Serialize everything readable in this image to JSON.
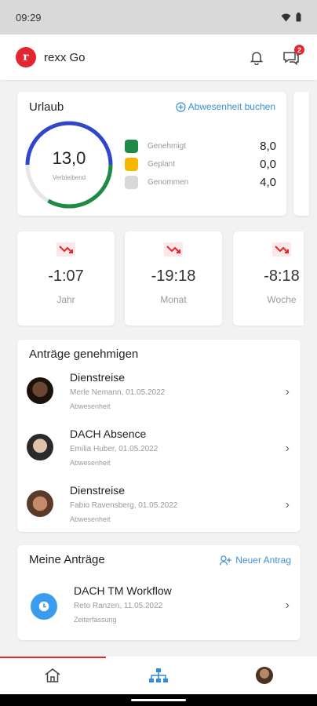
{
  "status": {
    "time": "09:29"
  },
  "app": {
    "title": "rexx Go",
    "messages_badge": "2"
  },
  "vacation": {
    "title": "Urlaub",
    "book_label": "Abwesenheit buchen",
    "remaining_value": "13,0",
    "remaining_label": "Verbleibend",
    "colors": {
      "approved": "#1e8a46",
      "planned": "#f5b800",
      "taken": "#d9d9d9",
      "ring_blue": "#3147c9"
    },
    "legend": [
      {
        "label": "Genehmigt",
        "value": "8,0"
      },
      {
        "label": "Geplant",
        "value": "0,0"
      },
      {
        "label": "Genommen",
        "value": "4,0"
      }
    ]
  },
  "time_balances": [
    {
      "value": "-1:07",
      "label": "Jahr"
    },
    {
      "value": "-19:18",
      "label": "Monat"
    },
    {
      "value": "-8:18",
      "label": "Woche"
    }
  ],
  "approvals": {
    "title": "Anträge genehmigen",
    "items": [
      {
        "title": "Dienstreise",
        "meta": "Merle Nemann, 01.05.2022",
        "type": "Abwesenheit"
      },
      {
        "title": "DACH Absence",
        "meta": "Emilia Huber, 01.05.2022",
        "type": "Abwesenheit"
      },
      {
        "title": "Dienstreise",
        "meta": "Fabio Ravensberg, 01.05.2022",
        "type": "Abwesenheit"
      }
    ]
  },
  "my_requests": {
    "title": "Meine Anträge",
    "new_label": "Neuer Antrag",
    "items": [
      {
        "title": "DACH TM Workflow",
        "meta": "Reto Ranzen, 11.05.2022",
        "type": "Zeiterfassung"
      }
    ]
  }
}
